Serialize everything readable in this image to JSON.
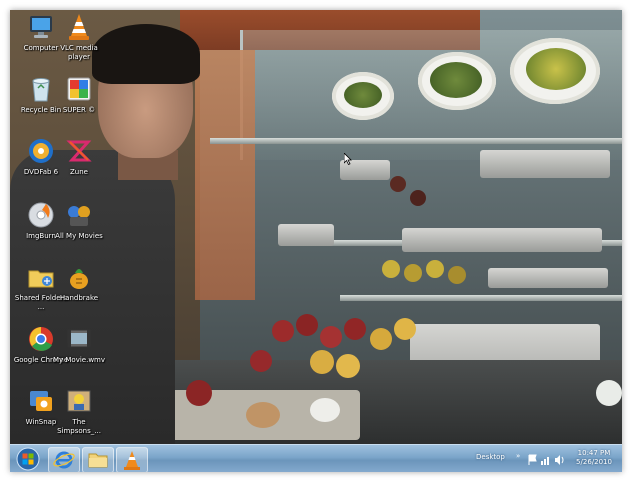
{
  "desktop": {
    "icons": [
      {
        "label": "Computer",
        "icon": "computer-icon"
      },
      {
        "label": "VLC media player",
        "icon": "vlc-cone-icon"
      },
      {
        "label": "Recycle Bin",
        "icon": "recycle-bin-icon"
      },
      {
        "label": "SUPER ©",
        "icon": "super-icon"
      },
      {
        "label": "DVDFab 6",
        "icon": "dvdfab-icon"
      },
      {
        "label": "Zune",
        "icon": "zune-icon"
      },
      {
        "label": "ImgBurn",
        "icon": "imgburn-disc-icon"
      },
      {
        "label": "All My Movies",
        "icon": "all-my-movies-icon"
      },
      {
        "label": "Shared Folders ...",
        "icon": "shared-folders-icon"
      },
      {
        "label": "Handbrake",
        "icon": "handbrake-icon"
      },
      {
        "label": "Google Chrome",
        "icon": "chrome-icon"
      },
      {
        "label": "My Movie.wmv",
        "icon": "video-file-icon"
      },
      {
        "label": "WinSnap",
        "icon": "winsnap-icon"
      },
      {
        "label": "The Simpsons_...",
        "icon": "video-thumbnail-icon"
      }
    ]
  },
  "taskbar": {
    "start_icon": "windows-orb-icon",
    "pinned": [
      {
        "name": "Internet Explorer",
        "icon": "internet-explorer-icon"
      },
      {
        "name": "Windows Explorer",
        "icon": "folder-icon"
      },
      {
        "name": "VLC media player",
        "icon": "vlc-cone-icon"
      }
    ],
    "desktop_label": "Desktop",
    "tray_icons": [
      "flag-icon",
      "network-icon",
      "volume-icon"
    ],
    "clock": {
      "time": "10:47 PM",
      "date": "5/26/2010"
    }
  },
  "colors": {
    "taskbar": "#7aa4c9",
    "vlc_orange": "#f08a1c",
    "chrome_red": "#d93a2b"
  }
}
